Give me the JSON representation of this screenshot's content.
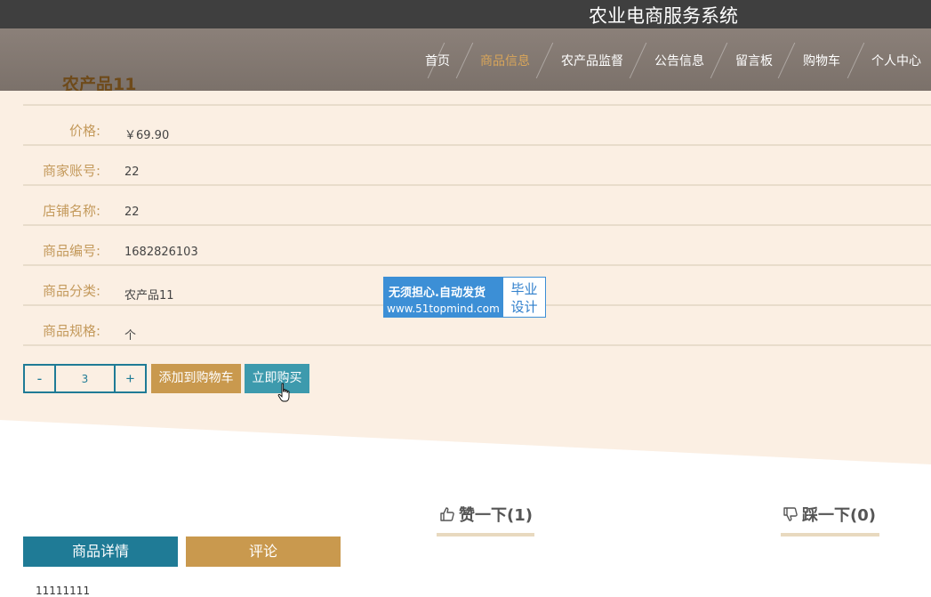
{
  "site": {
    "title": "农业电商服务系统"
  },
  "nav": {
    "items": [
      {
        "label": "首页"
      },
      {
        "label": "商品信息"
      },
      {
        "label": "农产品监督"
      },
      {
        "label": "公告信息"
      },
      {
        "label": "留言板"
      },
      {
        "label": "购物车"
      },
      {
        "label": "个人中心"
      }
    ],
    "active_index": 1
  },
  "product": {
    "name": "农产品11",
    "fields": [
      {
        "label": "价格:",
        "value": "￥69.90"
      },
      {
        "label": "商家账号:",
        "value": "22"
      },
      {
        "label": "店铺名称:",
        "value": "22"
      },
      {
        "label": "商品编号:",
        "value": "1682826103"
      },
      {
        "label": "商品分类:",
        "value": "农产品11"
      },
      {
        "label": "商品规格:",
        "value": "个"
      }
    ]
  },
  "quantity": {
    "minus": "-",
    "value": "3",
    "plus": "+"
  },
  "actions": {
    "add_to_cart": "添加到购物车",
    "buy_now": "立即购买"
  },
  "watermark": {
    "line1": "无须担心.自动发货",
    "line2": "www.51topmind.com",
    "badge_line1": "毕业",
    "badge_line2": "设计"
  },
  "votes": {
    "like": "赞一下(1)",
    "dislike": "踩一下(0)"
  },
  "tabs": {
    "detail": "商品详情",
    "comment": "评论"
  },
  "detail_content": "11111111",
  "colors": {
    "topbar": "#3f3f3f",
    "navbar": "#7b716a",
    "nav_active": "#d8a55a",
    "accent_blue": "#1f7b96",
    "accent_gold": "#c9994e",
    "buy_button": "#3d9aad",
    "panel_bg": "#fbefe3"
  },
  "icons": {
    "like": "thumbs-up-icon",
    "dislike": "thumbs-down-icon",
    "cursor": "hand-pointer-icon"
  }
}
